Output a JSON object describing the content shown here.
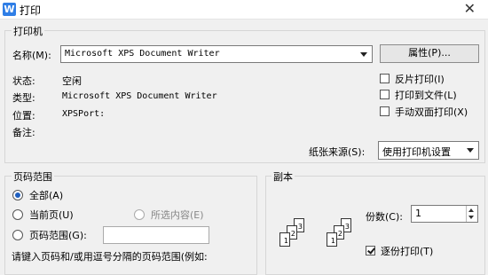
{
  "window": {
    "title": "打印",
    "app_icon_letter": "W",
    "close_symbol": "✕"
  },
  "printer": {
    "group_label": "打印机",
    "name_label": "名称(M):",
    "name_value": "Microsoft XPS Document Writer",
    "properties_button": "属性(P)...",
    "status_label": "状态:",
    "status_value": "空闲",
    "type_label": "类型:",
    "type_value": "Microsoft XPS Document Writer",
    "where_label": "位置:",
    "where_value": "XPSPort:",
    "comment_label": "备注:",
    "options": [
      {
        "label": "反片打印(I)",
        "checked": false
      },
      {
        "label": "打印到文件(L)",
        "checked": false
      },
      {
        "label": "手动双面打印(X)",
        "checked": false
      }
    ],
    "paper_source_label": "纸张来源(S):",
    "paper_source_value": "使用打印机设置"
  },
  "page_range": {
    "group_label": "页码范围",
    "all_label": "全部(A)",
    "current_label": "当前页(U)",
    "selection_label": "所选内容(E)",
    "pages_label": "页码范围(G):",
    "pages_value": "",
    "hint": "请键入页码和/或用逗号分隔的页码范围(例如:",
    "selected": "all"
  },
  "copies": {
    "group_label": "副本",
    "count_label": "份数(C):",
    "count_value": "1",
    "collate_label": "逐份打印(T)",
    "collate_checked": true,
    "page_numbers": [
      "3",
      "2",
      "1"
    ]
  }
}
